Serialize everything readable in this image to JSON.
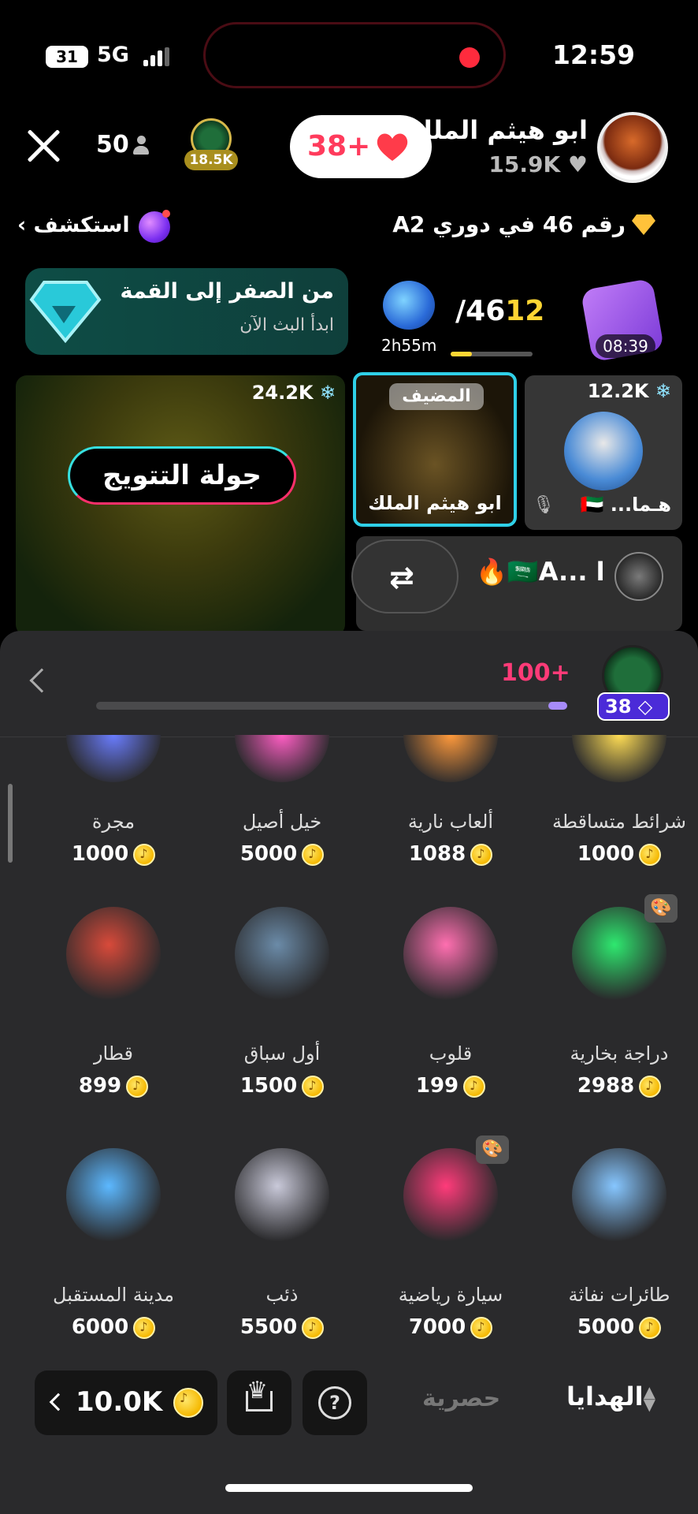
{
  "status_bar": {
    "battery": "31",
    "network": "5G",
    "time": "12:59"
  },
  "header": {
    "viewer_count": "50",
    "rank_label": "18.5K",
    "hearts_label": "38+",
    "host_name": "ابو هيثم الملك",
    "host_likes": "15.9K"
  },
  "league": {
    "explore_label": "استكشف",
    "rank_text": "رقم 46 في دوري A2"
  },
  "promo": {
    "title": "من الصفر إلى القمة",
    "subtitle": "ابدأ البث الآن"
  },
  "pet": {
    "timer": "2h55m"
  },
  "task_progress": {
    "current": "12",
    "total": "/46",
    "fraction": 0.26
  },
  "gift_box": {
    "timer": "08:39"
  },
  "tiles": {
    "main_count": "24.2K",
    "coronation_label": "جولة التتويج",
    "host_tag": "المضيف",
    "host_tile_name": "ابو هيثم الملك",
    "guest_count": "12.2K",
    "guest_name": "هـما...",
    "guest_flag": "🇦🇪",
    "row2_name": "A... ا",
    "row2_emoji": "🔥🇸🇦",
    "swap_icon": "⇄"
  },
  "gift_panel": {
    "level_gain": "100+",
    "level_fraction": 0.96,
    "level_badge": "38",
    "rows": [
      [
        {
          "name": "شرائط متساقطة",
          "price": "1000"
        },
        {
          "name": "ألعاب نارية",
          "price": "1088"
        },
        {
          "name": "خيل أصيل",
          "price": "5000"
        },
        {
          "name": "مجرة",
          "price": "1000"
        }
      ],
      [
        {
          "name": "دراجة بخارية",
          "price": "2988"
        },
        {
          "name": "قلوب",
          "price": "199"
        },
        {
          "name": "أول سباق",
          "price": "1500"
        },
        {
          "name": "قطار",
          "price": "899"
        }
      ],
      [
        {
          "name": "طائرات نفاثة",
          "price": "5000"
        },
        {
          "name": "سيارة رياضية",
          "price": "7000"
        },
        {
          "name": "ذئب",
          "price": "5500"
        },
        {
          "name": "مدينة المستقبل",
          "price": "6000"
        }
      ]
    ]
  },
  "bottom_bar": {
    "balance": "10.0K",
    "tab_exclusive": "حصرية",
    "tab_gifts": "الهدايا"
  },
  "colors": {
    "accent_pink": "#ff3b78",
    "coin_gold": "#f5b800",
    "host_border": "#2fd0e8",
    "badge_purple": "#4b2bd8"
  }
}
